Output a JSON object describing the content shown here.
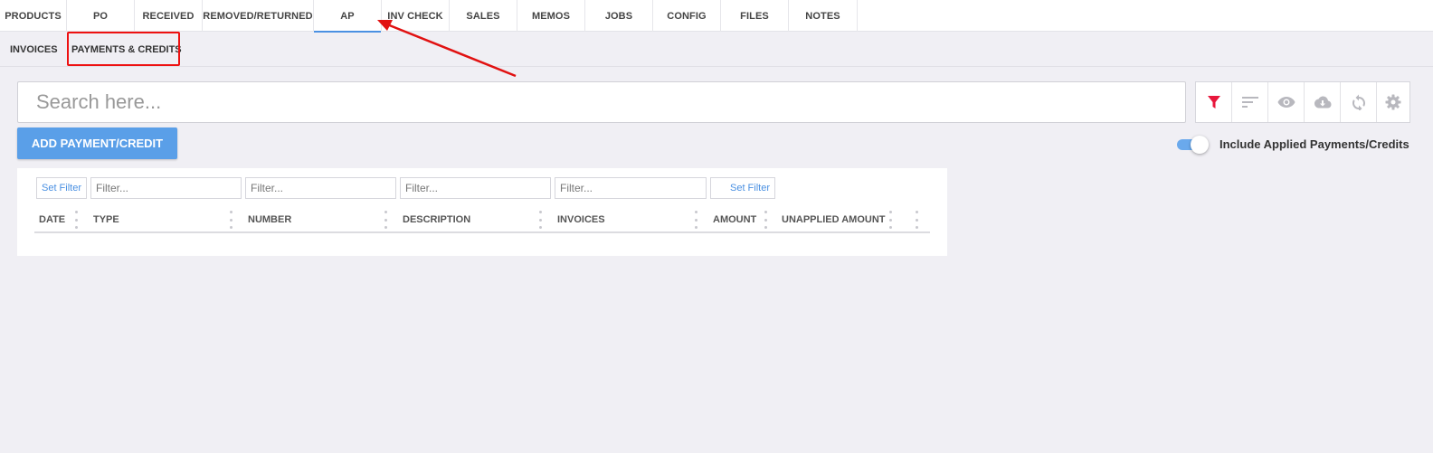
{
  "top_tabs": [
    {
      "label": "PRODUCTS"
    },
    {
      "label": "PO"
    },
    {
      "label": "RECEIVED"
    },
    {
      "label": "REMOVED/RETURNED"
    },
    {
      "label": "AP",
      "active": true
    },
    {
      "label": "INV CHECK"
    },
    {
      "label": "SALES"
    },
    {
      "label": "MEMOS"
    },
    {
      "label": "JOBS"
    },
    {
      "label": "CONFIG"
    },
    {
      "label": "FILES"
    },
    {
      "label": "NOTES"
    }
  ],
  "sub_tabs": [
    {
      "label": "INVOICES"
    },
    {
      "label": "PAYMENTS & CREDITS",
      "active": true
    }
  ],
  "search": {
    "placeholder": "Search here...",
    "value": ""
  },
  "toolbar": {
    "icons": [
      "filter-icon",
      "sort-icon",
      "view-icon",
      "download-icon",
      "refresh-icon",
      "settings-icon"
    ],
    "filter_color": "#e8173c",
    "icon_color": "#b8b8be"
  },
  "add_button": {
    "label": "ADD PAYMENT/CREDIT"
  },
  "toggle": {
    "label": "Include Applied Payments/Credits",
    "on": true
  },
  "table": {
    "set_filter_label": "Set Filter",
    "filter_placeholder": "Filter...",
    "columns": [
      "DATE",
      "TYPE",
      "NUMBER",
      "DESCRIPTION",
      "INVOICES",
      "AMOUNT",
      "UNAPPLIED AMOUNT"
    ],
    "rows": []
  },
  "colors": {
    "accent": "#4a90e2",
    "button": "#5a9fe8",
    "annotation": "#e11111",
    "background": "#f0eff4"
  }
}
